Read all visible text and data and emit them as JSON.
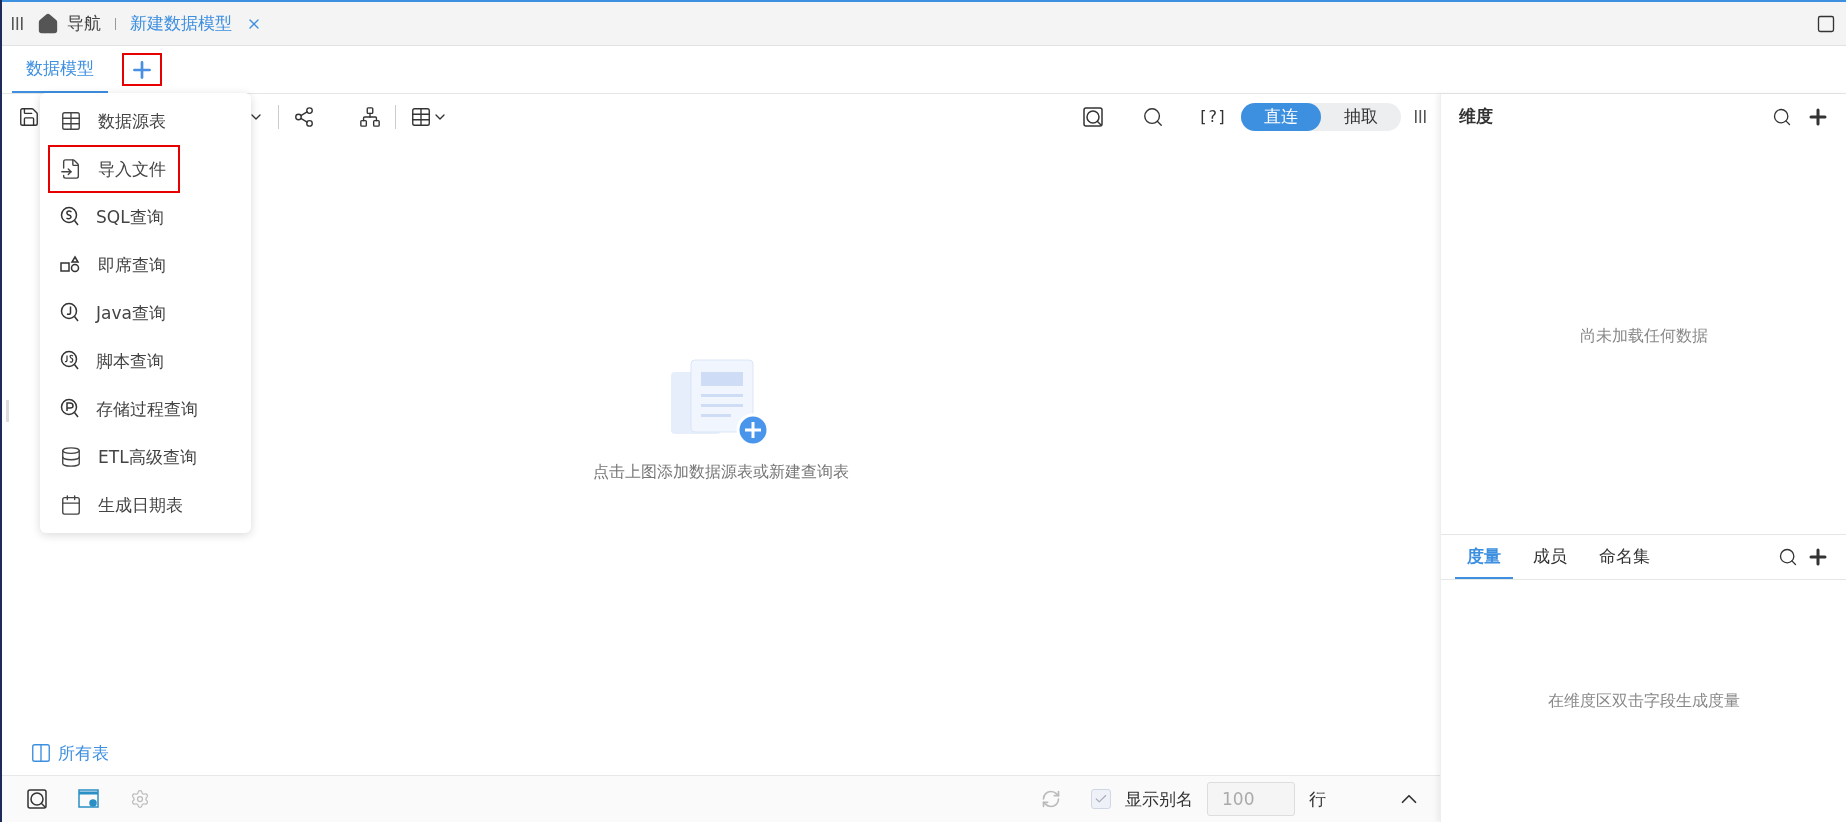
{
  "header": {
    "nav_label": "导航",
    "tabs": [
      {
        "label": "新建数据模型",
        "selected": true
      }
    ]
  },
  "model_tabs": [
    {
      "label": "数据模型",
      "selected": true
    }
  ],
  "add_button": {
    "highlighted": true
  },
  "menu": {
    "items": [
      {
        "label": "数据源表",
        "kind": "table",
        "highlighted": false
      },
      {
        "label": "导入文件",
        "kind": "import",
        "highlighted": true
      },
      {
        "label": "SQL查询",
        "kind": "sql",
        "highlighted": false
      },
      {
        "label": "即席查询",
        "kind": "adhoc",
        "highlighted": false
      },
      {
        "label": "Java查询",
        "kind": "java",
        "highlighted": false
      },
      {
        "label": "脚本查询",
        "kind": "script",
        "highlighted": false
      },
      {
        "label": "存储过程查询",
        "kind": "procedure",
        "highlighted": false
      },
      {
        "label": "ETL高级查询",
        "kind": "etl",
        "highlighted": false
      },
      {
        "label": "生成日期表",
        "kind": "calendar",
        "highlighted": false
      }
    ]
  },
  "toolbar": {
    "help": "[?]",
    "modes": [
      {
        "label": "直连",
        "selected": true
      },
      {
        "label": "抽取",
        "selected": false
      }
    ]
  },
  "canvas": {
    "empty_text": "点击上图添加数据源表或新建查询表",
    "all_tables": "所有表"
  },
  "footer": {
    "show_alias": {
      "label": "显示别名",
      "checked": true,
      "disabled": true
    },
    "row_limit": {
      "value": "100",
      "disabled": true
    },
    "row_unit": "行"
  },
  "dimensions": {
    "title": "维度",
    "empty_text": "尚未加载任何数据"
  },
  "measures": {
    "tabs": [
      {
        "label": "度量",
        "selected": true
      },
      {
        "label": "成员",
        "selected": false
      },
      {
        "label": "命名集",
        "selected": false
      }
    ],
    "empty_text": "在维度区双击字段生成度量"
  }
}
